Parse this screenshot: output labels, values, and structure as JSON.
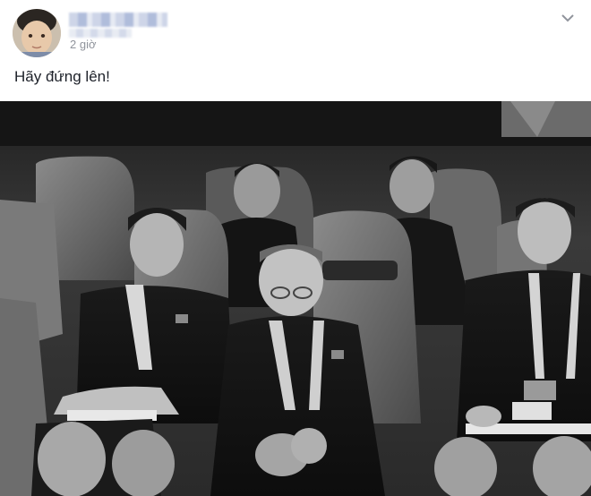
{
  "post": {
    "time": "2 giờ",
    "text": "Hãy đứng lên!"
  },
  "icons": {
    "menu": "chevron-down-icon"
  },
  "colors": {
    "timestamp": "#90949c",
    "text": "#1d2129"
  }
}
